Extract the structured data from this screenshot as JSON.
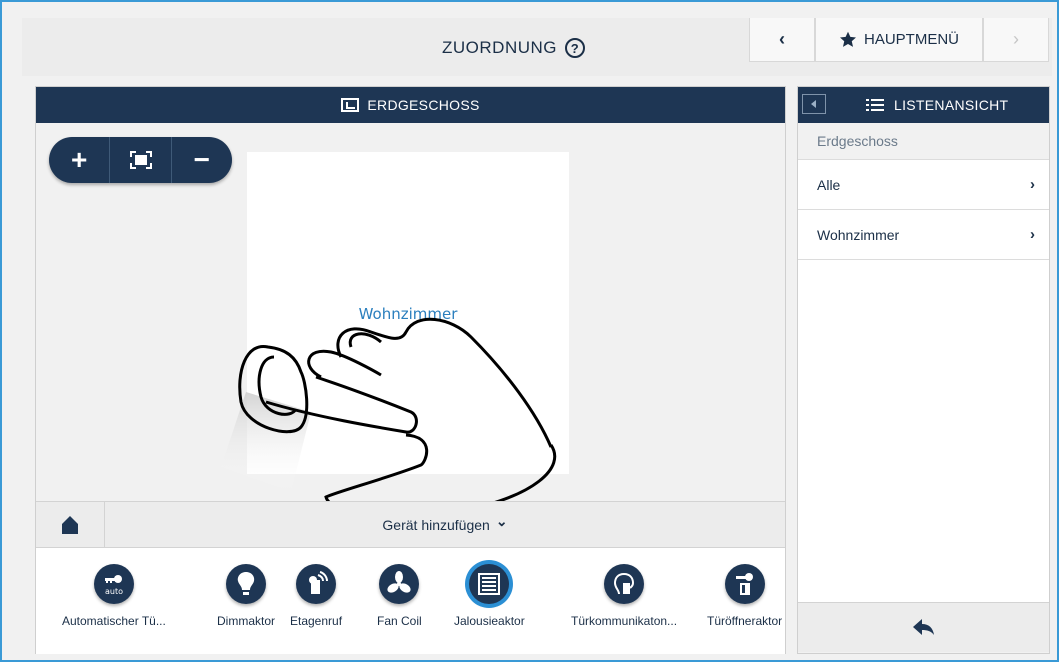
{
  "header": {
    "title": "ZUORDNUNG",
    "help_icon": "?",
    "back_label": "‹",
    "main_menu_label": "HAUPTMENÜ",
    "forward_label": "›"
  },
  "map": {
    "floor_title": "ERDGESCHOSS",
    "zoom_in": "+",
    "zoom_out": "−",
    "room_label": "Wohnzimmer",
    "add_device_label": "Gerät hinzufügen",
    "add_device_chevron": "⌄"
  },
  "devices": [
    {
      "label": "Automatischer Tü...",
      "icon": "auto-key-icon",
      "glyph": "auto"
    },
    {
      "label": "Dimmaktor",
      "icon": "lightbulb-icon",
      "glyph": ""
    },
    {
      "label": "Etagenruf",
      "icon": "door-bell-icon",
      "glyph": ""
    },
    {
      "label": "Fan Coil",
      "icon": "fan-icon",
      "glyph": ""
    },
    {
      "label": "Jalousieaktor",
      "icon": "blind-icon",
      "glyph": ""
    },
    {
      "label": "Türkommunikaton...",
      "icon": "intercom-icon",
      "glyph": ""
    },
    {
      "label": "Türöffneraktor",
      "icon": "door-opener-icon",
      "glyph": ""
    }
  ],
  "list": {
    "title": "LISTENANSICHT",
    "subtitle": "Erdgeschoss",
    "items": [
      {
        "label": "Alle",
        "chevron": "›"
      },
      {
        "label": "Wohnzimmer",
        "chevron": "›"
      }
    ]
  },
  "colors": {
    "navy": "#1e3654",
    "accent": "#2b8fd4",
    "frame": "#3a9ad6"
  }
}
